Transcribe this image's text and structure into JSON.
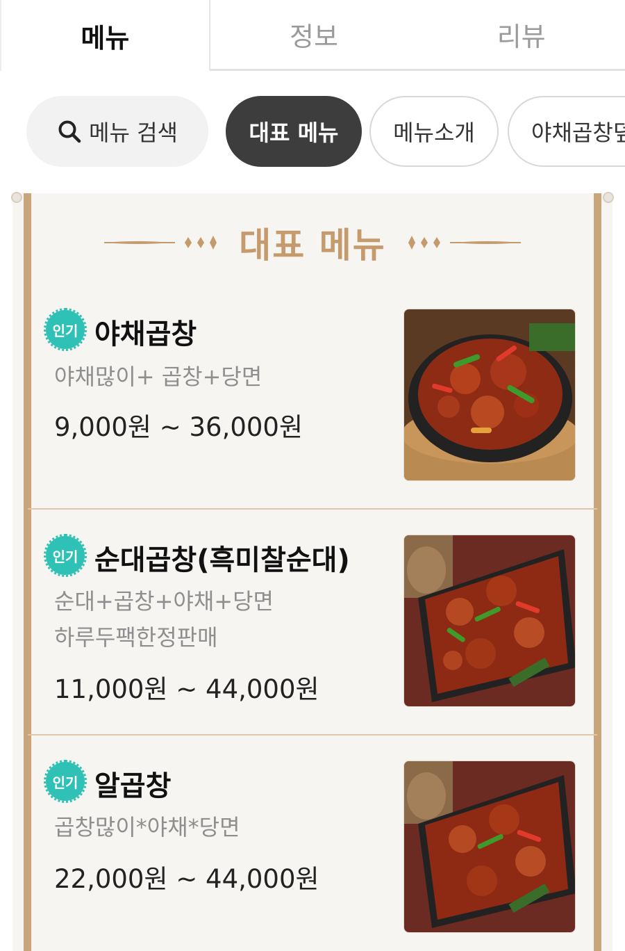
{
  "tabs": [
    {
      "label": "메뉴",
      "active": true
    },
    {
      "label": "정보",
      "active": false
    },
    {
      "label": "리뷰",
      "active": false
    }
  ],
  "chips": {
    "search": "메뉴 검색",
    "representative": "대표 메뉴",
    "intro": "메뉴소개",
    "vegetable": "야채곱창덮밥"
  },
  "section": {
    "title": "대표 메뉴"
  },
  "badge_label": "인기",
  "menu_items": [
    {
      "name": "야채곱창",
      "desc_lines": [
        "야채많이+ 곱창+당면"
      ],
      "price": "9,000원 ~ 36,000원",
      "photo_icon": "stir-fried-gopchang-pan-photo"
    },
    {
      "name": "순대곱창(흑미찰순대)",
      "desc_lines": [
        "순대+곱창+야채+당면",
        "하루두팩한정판매"
      ],
      "price": "11,000원 ~ 44,000원",
      "photo_icon": "sundae-gopchang-tray-photo"
    },
    {
      "name": "알곱창",
      "desc_lines": [
        "곱창많이*야채*당면"
      ],
      "price": "22,000원 ~ 44,000원",
      "photo_icon": "al-gopchang-tray-photo"
    }
  ],
  "colors": {
    "accent_gold": "#c59b6d",
    "badge_teal": "#2fc1b5",
    "active_chip": "#3d3d3d"
  }
}
